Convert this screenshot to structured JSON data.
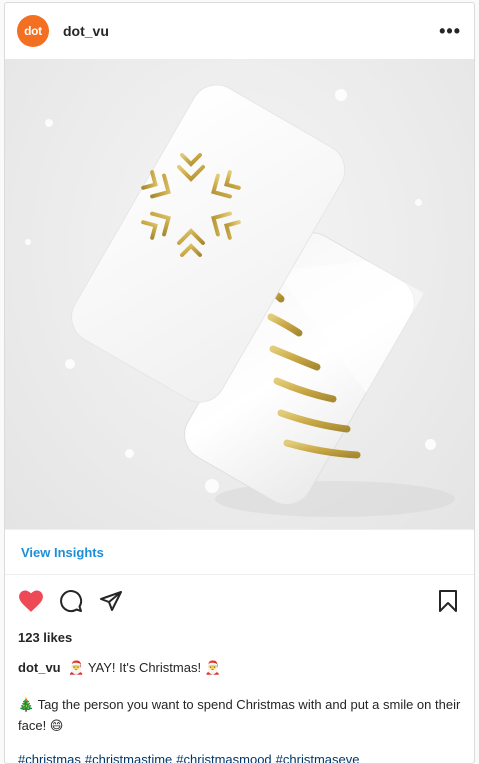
{
  "post": {
    "account": {
      "avatar_text": "dot",
      "username": "dot_vu",
      "brand_color": "#f36f21"
    },
    "more_icon": "more-horizontal-icon",
    "view_insights_label": "View Insights",
    "likes_text": "123 likes",
    "caption": {
      "username": "dot_vu",
      "line1": "🎅 YAY! It's Christmas! 🎅",
      "line2": "🎄 Tag the person you want to spend Christmas with and put a smile on their face! 😄"
    },
    "hashtags": [
      "#christmas",
      "#christmastime",
      "#christmasmood",
      "#christmaseve"
    ],
    "colors": {
      "link_blue": "#1d8fd8",
      "hashtag": "#00376b",
      "like_red": "#ed4956",
      "gold": "#c9a845"
    }
  }
}
